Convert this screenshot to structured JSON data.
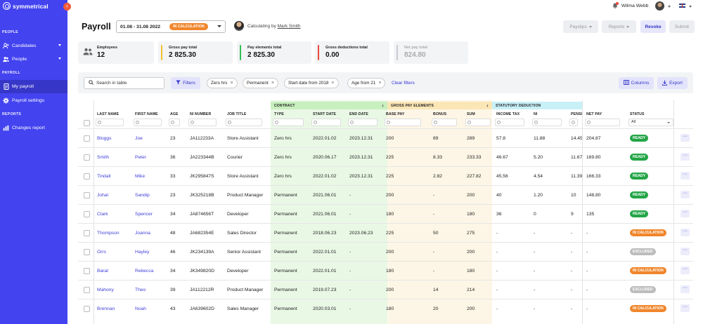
{
  "app": {
    "logo": "symmetrical"
  },
  "sidebar": {
    "sections": {
      "people": "PEOPLE",
      "payroll": "PAYROLL",
      "reports": "REPORTS"
    },
    "items": [
      {
        "label": "Candidates",
        "icon": "user-plus-icon"
      },
      {
        "label": "People",
        "icon": "users-icon"
      },
      {
        "label": "My payroll",
        "icon": "payroll-icon"
      },
      {
        "label": "Payroll settings",
        "icon": "gear-icon"
      },
      {
        "label": "Changes report",
        "icon": "bar-chart-icon"
      }
    ]
  },
  "topbar": {
    "user_name": "Wilma Webb"
  },
  "header": {
    "title": "Payroll",
    "period": "01.08 - 31.08 2022",
    "period_status": "IN CALCULATION",
    "calculating_prefix": "Calculating by ",
    "calculating_by": "Mark Smith",
    "buttons": {
      "payslips": "Payslips",
      "reports": "Reports",
      "revoke": "Revoke",
      "submit": "Submit"
    }
  },
  "stats": [
    {
      "label": "Employees",
      "value": "12",
      "color": ""
    },
    {
      "label": "Gross pay total",
      "value": "2 825.30",
      "color": "#f2c12e"
    },
    {
      "label": "Pay elements total",
      "value": "2 825.30",
      "color": "#2fbf55"
    },
    {
      "label": "Gross deductions total",
      "value": "0.00",
      "color": "#e84a3c"
    },
    {
      "label": "Net pay total",
      "value": "824.80",
      "color": "#c9cbd1"
    }
  ],
  "filters": {
    "search_placeholder": "Search in table",
    "filters_label": "Filters",
    "chips": [
      "Zero hrs",
      "Permanent",
      "Start date from 2018",
      "Age from 21"
    ],
    "clear_label": "Clear filters",
    "columns_label": "Columns",
    "export_label": "Export"
  },
  "table": {
    "groups": {
      "contract": "CONTRACT",
      "gross": "GROSS PAY ELEMENTS",
      "statutory": "STATUTORY DEDUCTION"
    },
    "columns": [
      "LAST NAME",
      "FIRST NAME",
      "AGE",
      "NI NUMBER",
      "JOB TITLE",
      "TYPE",
      "START DATE",
      "END DATE",
      "BASE PAY",
      "BONUS",
      "SUM",
      "INCOME TAX",
      "NI",
      "PENSION",
      "NET PAY",
      "STATUS"
    ],
    "status_filter": "All",
    "status_colors": {
      "READY": "#23a547",
      "IN CALCULATION": "#f0862b",
      "EXCLUDED": "#bdbdbd"
    },
    "rows": [
      [
        "Bloggs",
        "Joe",
        "23",
        "JA112233A",
        "Store Assistant",
        "Zero hrs",
        "2022.01.02",
        "2023.12.31",
        "200",
        "89",
        "289",
        "57.8",
        "11.88",
        "14.45",
        "204.87",
        "READY"
      ],
      [
        "Smith",
        "Peter",
        "36",
        "JA223344B",
        "Courier",
        "Zero hrs",
        "2020.06.17",
        "2023.12.31",
        "225",
        "8.33",
        "233.33",
        "46.67",
        "5.20",
        "11.67",
        "169.80",
        "READY"
      ],
      [
        "Tindall",
        "Mike",
        "33",
        "JK295847S",
        "Store Assistant",
        "Zero hrs",
        "2022.01.02",
        "2023.12.31",
        "225",
        "2.82",
        "227.82",
        "45.56",
        "4.54",
        "11.39",
        "166.33",
        "READY"
      ],
      [
        "Johal",
        "Sandip",
        "23",
        "JK325218B",
        "Product Manager",
        "Permanent",
        "2021.06.01",
        "-",
        "200",
        "-",
        "200",
        "40",
        "1.20",
        "10",
        "148.80",
        "READY"
      ],
      [
        "Clark",
        "Spencer",
        "34",
        "JA874656T",
        "Developer",
        "Permanent",
        "2021.06.01",
        "-",
        "180",
        "-",
        "180",
        "36",
        "0",
        "9",
        "135",
        "READY"
      ],
      [
        "Thompson",
        "Joanna",
        "48",
        "JA682354E",
        "Sales Director",
        "Permanent",
        "2018.06.23",
        "2023.06.23",
        "225",
        "50",
        "275",
        "-",
        "-",
        "-",
        "-",
        "IN CALCULATION"
      ],
      [
        "Orrs",
        "Hayley",
        "46",
        "JK234139A",
        "Senior Assistant",
        "Permanent",
        "2022.01.01",
        "-",
        "200",
        "-",
        "200",
        "-",
        "-",
        "-",
        "-",
        "EXCLUDED"
      ],
      [
        "Barat",
        "Rebecca",
        "34",
        "JK349820D",
        "Developer",
        "Permanent",
        "2022.01.01",
        "-",
        "180",
        "-",
        "180",
        "-",
        "-",
        "-",
        "-",
        "IN CALCULATION"
      ],
      [
        "Mahony",
        "Theo",
        "39",
        "JA112212R",
        "Product Manager",
        "Permanent",
        "2019.07.23",
        "-",
        "200",
        "14",
        "214",
        "-",
        "-",
        "-",
        "-",
        "EXCLUDED"
      ],
      [
        "Brennan",
        "Noah",
        "43",
        "JA639602D",
        "Sales Manager",
        "Permanent",
        "2020.03.01",
        "-",
        "180",
        "20",
        "200",
        "-",
        "-",
        "-",
        "-",
        "IN CALCULATION"
      ]
    ]
  }
}
